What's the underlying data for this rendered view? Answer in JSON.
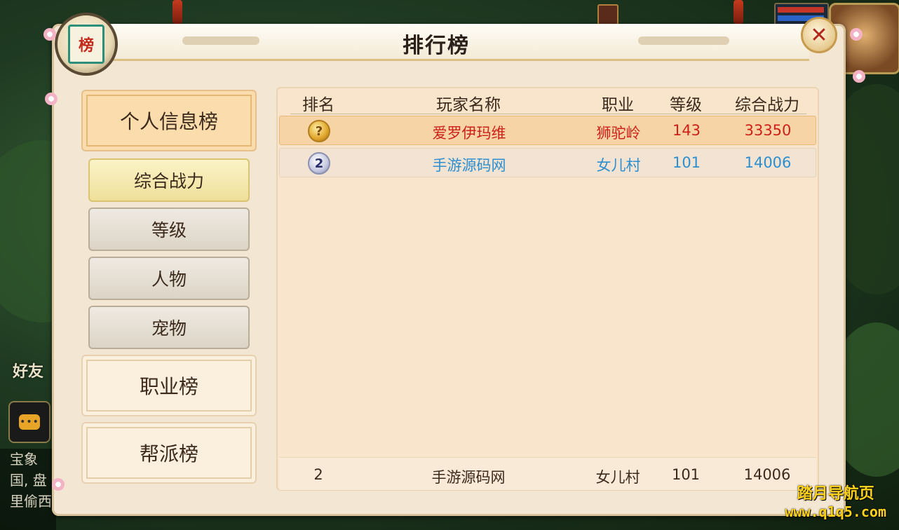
{
  "panel": {
    "title": "排行榜",
    "emblem_char": "榜"
  },
  "close_glyph": "✕",
  "categories": [
    {
      "label": "个人信息榜",
      "active": true
    },
    {
      "label": "职业榜",
      "active": false
    },
    {
      "label": "帮派榜",
      "active": false
    }
  ],
  "subtabs": [
    {
      "label": "综合战力",
      "active": true
    },
    {
      "label": "等级",
      "active": false
    },
    {
      "label": "人物",
      "active": false
    },
    {
      "label": "宠物",
      "active": false
    }
  ],
  "table": {
    "headers": [
      "排名",
      "玩家名称",
      "职业",
      "等级",
      "综合战力"
    ],
    "rows": [
      {
        "rank": "1",
        "rank_glyph": "?",
        "medal": "gold-medal-icon",
        "name": "爱罗伊玛维",
        "school": "狮驼岭",
        "level": "143",
        "power": "33350",
        "color": "#cc2019"
      },
      {
        "rank": "2",
        "rank_glyph": "2",
        "medal": "silver-medal-icon",
        "name": "手游源码网",
        "school": "女儿村",
        "level": "101",
        "power": "14006",
        "color": "#2d8fd0"
      }
    ],
    "my_rank": {
      "rank": "2",
      "name": "手游源码网",
      "school": "女儿村",
      "level": "101",
      "power": "14006"
    }
  },
  "background_hud": {
    "side_label": "好友",
    "chat_icon": "speech-bubble-icon",
    "chat_lines": [
      "宝象",
      "国, 盘",
      "里偷西"
    ]
  },
  "watermark": {
    "line1": "踏月导航页",
    "line2": "www.q1q5.com"
  }
}
